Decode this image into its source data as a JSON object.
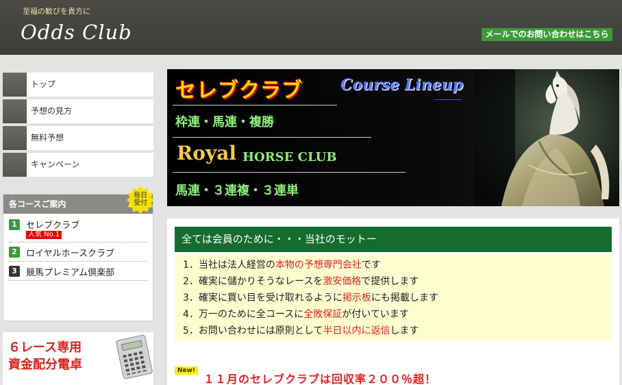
{
  "header": {
    "tagline": "至福の歓びを貴方に",
    "logo": "Odds Club",
    "contact_label": "メールでのお問い合わせはこちら"
  },
  "nav": {
    "items": [
      {
        "label": "トップ"
      },
      {
        "label": "予想の見方"
      },
      {
        "label": "無料予想"
      },
      {
        "label": "キャンペーン"
      }
    ]
  },
  "courses": {
    "heading": "各コースご案内",
    "badge_line1": "毎日",
    "badge_line2": "受付",
    "items": [
      {
        "num": "1",
        "label": "セレブクラブ",
        "color": "#3a9a3a",
        "tag": "人気 No.1"
      },
      {
        "num": "2",
        "label": "ロイヤルホースクラブ",
        "color": "#3a9a3a"
      },
      {
        "num": "3",
        "label": "競馬プレミアム倶楽部",
        "color": "#333333"
      }
    ]
  },
  "calc_banner": {
    "line1": "６レース専用",
    "line2": "資金配分電卓"
  },
  "banner": {
    "celeb": "セレブクラブ",
    "lineup": "Course Lineup",
    "bets1": "枠連・馬連・複勝",
    "royal": "Royal",
    "horse_club": "HORSE CLUB",
    "bets2": "馬連・３連複・３連単"
  },
  "motto": {
    "heading": "全ては会員のために・・・当社のモットー",
    "items": [
      {
        "pre": "1．当社は法人経営の",
        "hl": "本物の予想専門会社",
        "post": "です"
      },
      {
        "pre": "2．確実に儲かりそうなレースを",
        "hl": "激安価格",
        "post": "で提供します"
      },
      {
        "pre": "3．確実に買い目を受け取れるように",
        "hl": "掲示板",
        "post": "にも掲載します"
      },
      {
        "pre": "4．万一のために全コースに",
        "hl": "全敗保証",
        "post": "が付いています"
      },
      {
        "pre": "5．お問い合わせには原則として",
        "hl": "半日以内に返信",
        "post": "します"
      }
    ]
  },
  "news": {
    "badge": "New!",
    "text": "１１月のセレブクラブは回収率２００％超！"
  }
}
